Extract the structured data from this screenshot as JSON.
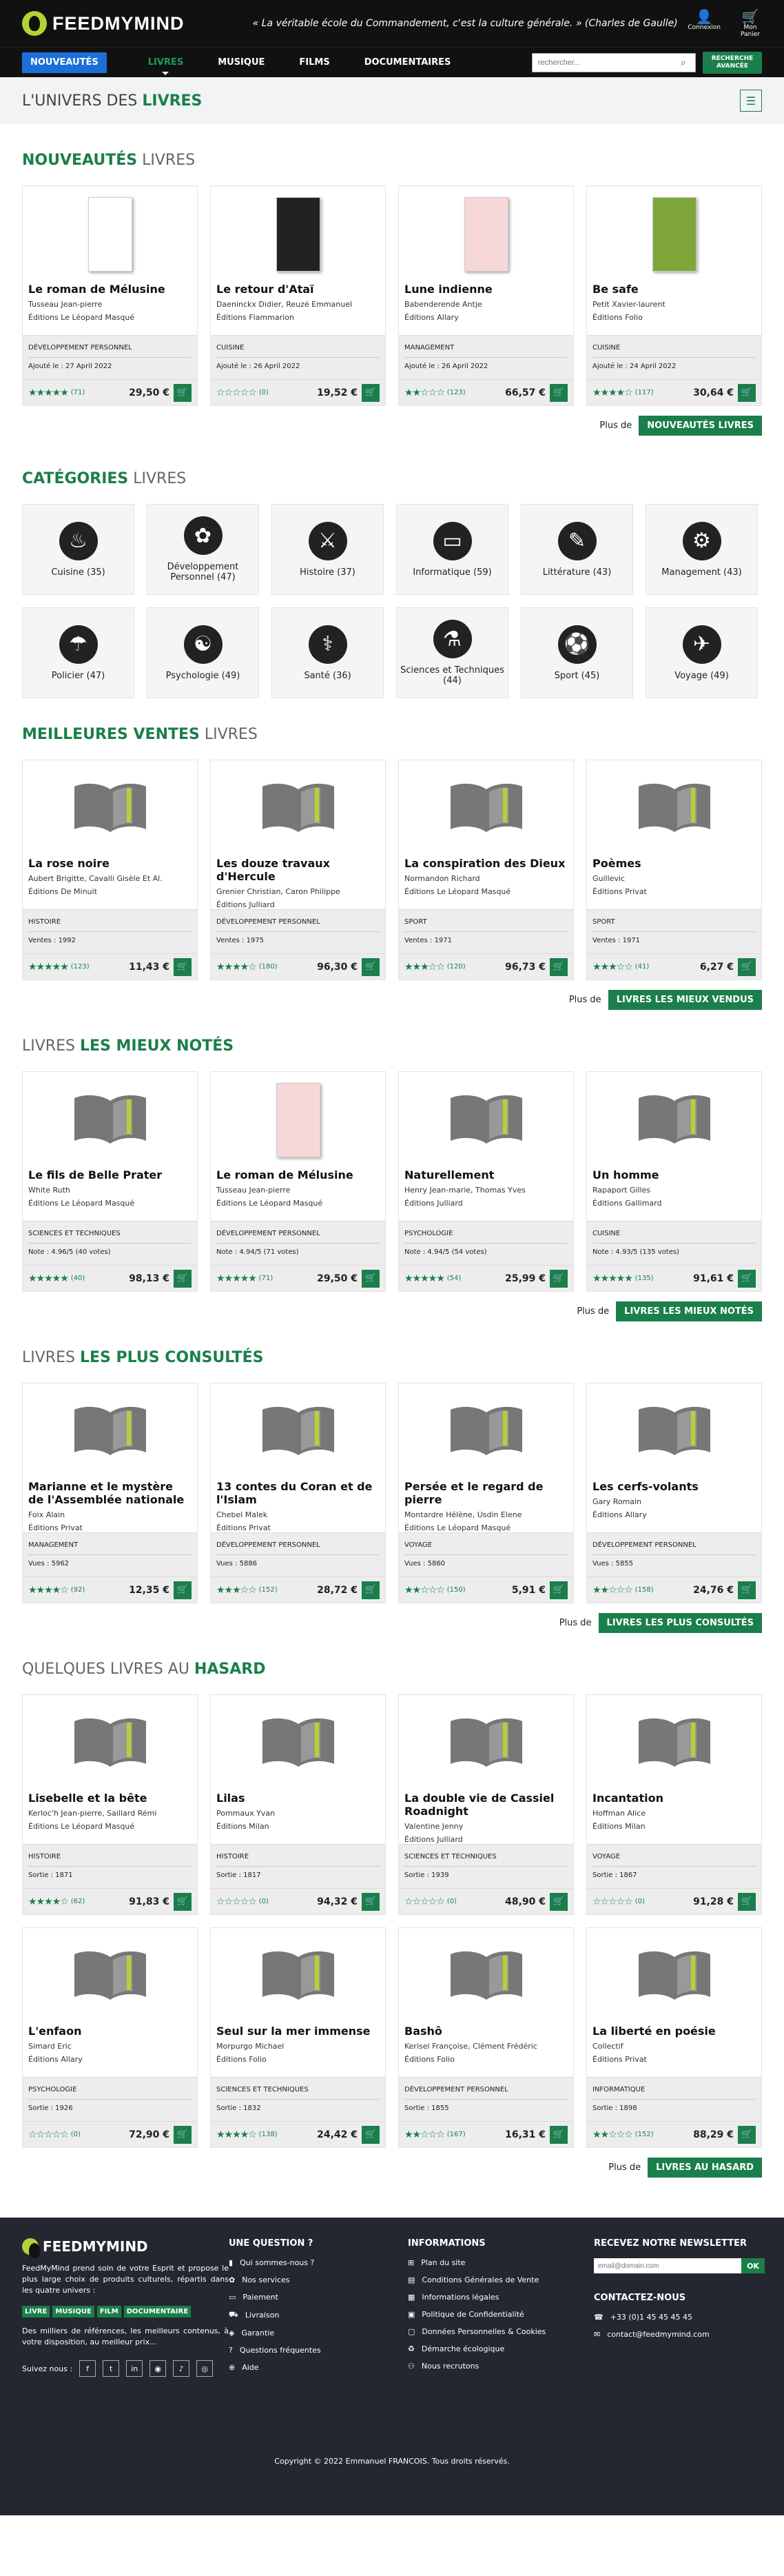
{
  "header": {
    "logo": "FEEDMYMIND",
    "quote": "« La véritable école du Commandement, c'est la culture générale. » (Charles de Gaulle)",
    "login": "Connexion",
    "cart": "Mon Panier"
  },
  "nav": {
    "items": [
      "NOUVEAUTÉS",
      "LIVRES",
      "MUSIQUE",
      "FILMS",
      "DOCUMENTAIRES"
    ],
    "search_placeholder": "rechercher...",
    "advanced": "RECHERCHE AVANCÉE"
  },
  "univers": {
    "title_a": "L'UNIVERS DES ",
    "title_b": "LIVRES"
  },
  "new_books": {
    "title_a": "NOUVEAUTÉS",
    "title_b": " LIVRES",
    "more": "Plus de",
    "button": "NOUVEAUTÉS LIVRES",
    "cards": [
      {
        "title": "Le roman de Mélusine",
        "author": "Tusseau Jean-pierre",
        "pub": "Éditions Le Léopard Masqué",
        "cat": "DÉVELOPPEMENT PERSONNEL",
        "info": "Ajouté le : 27 April 2022",
        "stars": "★★★★★",
        "count": "(71)",
        "price": "29,50 €",
        "cover": "white"
      },
      {
        "title": "Le retour d'Ataï",
        "author": "Daeninckx Didier, Reuzé Emmanuel",
        "pub": "Éditions Flammarion",
        "cat": "CUISINE",
        "info": "Ajouté le : 26 April 2022",
        "stars": "☆☆☆☆☆",
        "count": "(0)",
        "price": "19,52 €",
        "cover": "black"
      },
      {
        "title": "Lune indienne",
        "author": "Babenderende Antje",
        "pub": "Éditions Allary",
        "cat": "MANAGEMENT",
        "info": "Ajouté le : 26 April 2022",
        "stars": "★★☆☆☆",
        "count": "(123)",
        "price": "66,57 €",
        "cover": "color"
      },
      {
        "title": "Be safe",
        "author": "Petit Xavier-laurent",
        "pub": "Éditions Folio",
        "cat": "CUISINE",
        "info": "Ajouté le : 24 April 2022",
        "stars": "★★★★☆",
        "count": "(117)",
        "price": "30,64 €",
        "cover": "green"
      }
    ]
  },
  "categories": {
    "title_a": "CATÉGORIES",
    "title_b": " LIVRES",
    "items": [
      {
        "label": "Cuisine (35)",
        "icon": "♨"
      },
      {
        "label": "Développement Personnel (47)",
        "icon": "✿"
      },
      {
        "label": "Histoire (37)",
        "icon": "⚔"
      },
      {
        "label": "Informatique (59)",
        "icon": "▭"
      },
      {
        "label": "Littérature (43)",
        "icon": "✎"
      },
      {
        "label": "Management (43)",
        "icon": "⚙"
      },
      {
        "label": "Policier (47)",
        "icon": "☂"
      },
      {
        "label": "Psychologie (49)",
        "icon": "☯"
      },
      {
        "label": "Santé (36)",
        "icon": "⚕"
      },
      {
        "label": "Sciences et Techniques (44)",
        "icon": "⚗"
      },
      {
        "label": "Sport (45)",
        "icon": "⚽"
      },
      {
        "label": "Voyage (49)",
        "icon": "✈"
      }
    ]
  },
  "best": {
    "title_a": "MEILLEURES VENTES",
    "title_b": " LIVRES",
    "more": "Plus de",
    "button": "LIVRES LES MIEUX VENDUS",
    "cards": [
      {
        "title": "La rose noire",
        "author": "Aubert Brigitte, Cavalli Gisèle Et Al.",
        "pub": "Éditions De Minuit",
        "cat": "HISTOIRE",
        "info": "Ventes : 1992",
        "stars": "★★★★★",
        "count": "(123)",
        "price": "11,43 €"
      },
      {
        "title": "Les douze travaux d'Hercule",
        "author": "Grenier Christian, Caron Philippe",
        "pub": "Éditions Julliard",
        "cat": "DÉVELOPPEMENT PERSONNEL",
        "info": "Ventes : 1975",
        "stars": "★★★★☆",
        "count": "(180)",
        "price": "96,30 €"
      },
      {
        "title": "La conspiration des Dieux",
        "author": "Normandon Richard",
        "pub": "Éditions Le Léopard Masqué",
        "cat": "SPORT",
        "info": "Ventes : 1971",
        "stars": "★★★☆☆",
        "count": "(120)",
        "price": "96,73 €"
      },
      {
        "title": "Poèmes",
        "author": "Guillevic",
        "pub": "Éditions Privat",
        "cat": "SPORT",
        "info": "Ventes : 1971",
        "stars": "★★★☆☆",
        "count": "(41)",
        "price": "6,27 €"
      }
    ]
  },
  "top": {
    "title_a": "LIVRES ",
    "title_b": "LES MIEUX NOTÉS",
    "more": "Plus de",
    "button": "LIVRES LES MIEUX NOTÉS",
    "cards": [
      {
        "title": "Le fils de Belle Prater",
        "author": "White Ruth",
        "pub": "Éditions Le Léopard Masqué",
        "cat": "SCIENCES ET TECHNIQUES",
        "info": "Note : 4.96/5 (40 votes)",
        "stars": "★★★★★",
        "count": "(40)",
        "price": "98,13 €"
      },
      {
        "title": "Le roman de Mélusine",
        "author": "Tusseau Jean-pierre",
        "pub": "Éditions Le Léopard Masqué",
        "cat": "DÉVELOPPEMENT PERSONNEL",
        "info": "Note : 4.94/5 (71 votes)",
        "stars": "★★★★★",
        "count": "(71)",
        "price": "29,50 €",
        "cover": "color"
      },
      {
        "title": "Naturellement",
        "author": "Henry Jean-marie, Thomas Yves",
        "pub": "Éditions Julliard",
        "cat": "PSYCHOLOGIE",
        "info": "Note : 4.94/5 (54 votes)",
        "stars": "★★★★★",
        "count": "(54)",
        "price": "25,99 €"
      },
      {
        "title": "Un homme",
        "author": "Rapaport Gilles",
        "pub": "Éditions Gallimard",
        "cat": "CUISINE",
        "info": "Note : 4.93/5 (135 votes)",
        "stars": "★★★★★",
        "count": "(135)",
        "price": "91,61 €"
      }
    ]
  },
  "viewed": {
    "title_a": "LIVRES ",
    "title_b": "LES PLUS CONSULTÉS",
    "more": "Plus de",
    "button": "LIVRES LES PLUS CONSULTÉS",
    "cards": [
      {
        "title": "Marianne et le mystère de l'Assemblée nationale",
        "author": "Foix Alain",
        "pub": "Éditions Privat",
        "cat": "MANAGEMENT",
        "info": "Vues : 5962",
        "stars": "★★★★☆",
        "count": "(92)",
        "price": "12,35 €"
      },
      {
        "title": "13 contes du Coran et de l'Islam",
        "author": "Chebel Malek",
        "pub": "Éditions Privat",
        "cat": "DÉVELOPPEMENT PERSONNEL",
        "info": "Vues : 5886",
        "stars": "★★★☆☆",
        "count": "(152)",
        "price": "28,72 €"
      },
      {
        "title": "Persée et le regard de pierre",
        "author": "Montardre Hélène, Usdin Elene",
        "pub": "Éditions Le Léopard Masqué",
        "cat": "VOYAGE",
        "info": "Vues : 5860",
        "stars": "★★☆☆☆",
        "count": "(150)",
        "price": "5,91 €"
      },
      {
        "title": "Les cerfs-volants",
        "author": "Gary Romain",
        "pub": "Éditions Allary",
        "cat": "DÉVELOPPEMENT PERSONNEL",
        "info": "Vues : 5855",
        "stars": "★★☆☆☆",
        "count": "(158)",
        "price": "24,76 €"
      }
    ]
  },
  "random": {
    "title_a": "QUELQUES LIVRES AU ",
    "title_b": "HASARD",
    "more": "Plus de",
    "button": "LIVRES AU HASARD",
    "cards": [
      {
        "title": "Lisebelle et la bête",
        "author": "Kerloc'h Jean-pierre, Saillard Rémi",
        "pub": "Éditions Le Léopard Masqué",
        "cat": "HISTOIRE",
        "info": "Sortie : 1871",
        "stars": "★★★★☆",
        "count": "(62)",
        "price": "91,83 €"
      },
      {
        "title": "Lilas",
        "author": "Pommaux Yvan",
        "pub": "Éditions Milan",
        "cat": "HISTOIRE",
        "info": "Sortie : 1817",
        "stars": "☆☆☆☆☆",
        "count": "(0)",
        "price": "94,32 €"
      },
      {
        "title": "La double vie de Cassiel Roadnight",
        "author": "Valentine Jenny",
        "pub": "Éditions Julliard",
        "cat": "SCIENCES ET TECHNIQUES",
        "info": "Sortie : 1939",
        "stars": "☆☆☆☆☆",
        "count": "(0)",
        "price": "48,90 €"
      },
      {
        "title": "Incantation",
        "author": "Hoffman Alice",
        "pub": "Éditions Milan",
        "cat": "VOYAGE",
        "info": "Sortie : 1867",
        "stars": "☆☆☆☆☆",
        "count": "(0)",
        "price": "91,28 €"
      },
      {
        "title": "L'enfaon",
        "author": "Simard Eric",
        "pub": "Éditions Allary",
        "cat": "PSYCHOLOGIE",
        "info": "Sortie : 1926",
        "stars": "☆☆☆☆☆",
        "count": "(0)",
        "price": "72,90 €"
      },
      {
        "title": "Seul sur la mer immense",
        "author": "Morpurgo Michael",
        "pub": "Éditions Folio",
        "cat": "SCIENCES ET TECHNIQUES",
        "info": "Sortie : 1832",
        "stars": "★★★★☆",
        "count": "(138)",
        "price": "24,42 €"
      },
      {
        "title": "Bashô",
        "author": "Kerisel Françoise, Clément Frédéric",
        "pub": "Éditions Folio",
        "cat": "DÉVELOPPEMENT PERSONNEL",
        "info": "Sortie : 1855",
        "stars": "★★☆☆☆",
        "count": "(167)",
        "price": "16,31 €"
      },
      {
        "title": "La liberté en poésie",
        "author": "Collectif",
        "pub": "Éditions Privat",
        "cat": "INFORMATIQUE",
        "info": "Sortie : 1898",
        "stars": "★★☆☆☆",
        "count": "(152)",
        "price": "88,29 €"
      }
    ]
  },
  "footer": {
    "logo": "FEEDMYMIND",
    "desc": "FeedMyMind prend soin de votre Esprit et propose le plus large choix de produits culturels, répartis dans les quatre univers :",
    "tags": [
      "LIVRE",
      "MUSIQUE",
      "FILM",
      "DOCUMENTAIRE"
    ],
    "desc2": "Des milliers de références, les meilleurs contenus, à votre disposition, au meilleur prix...",
    "follow": "Suivez nous :",
    "q_title": "UNE QUESTION ?",
    "q_items": [
      "Qui sommes-nous ?",
      "Nos services",
      "Paiement",
      "Livraison",
      "Garantie",
      "Questions fréquentes",
      "Aide"
    ],
    "i_title": "INFORMATIONS",
    "i_items": [
      "Plan du site",
      "Conditions Générales de Vente",
      "Informations légales",
      "Politique de Confidentialité",
      "Données Personnelles & Cookies",
      "Démarche écologique",
      "Nous recrutons"
    ],
    "n_title": "RECEVEZ NOTRE NEWSLETTER",
    "n_placeholder": "email@domain.com",
    "n_ok": "OK",
    "c_title": "CONTACTEZ-NOUS",
    "phone": "+33 (0)1 45 45 45 45",
    "email": "contact@feedmymind.com",
    "copyright": "Copyright © 2022 Emmanuel FRANCOIS. Tous droits réservés."
  }
}
